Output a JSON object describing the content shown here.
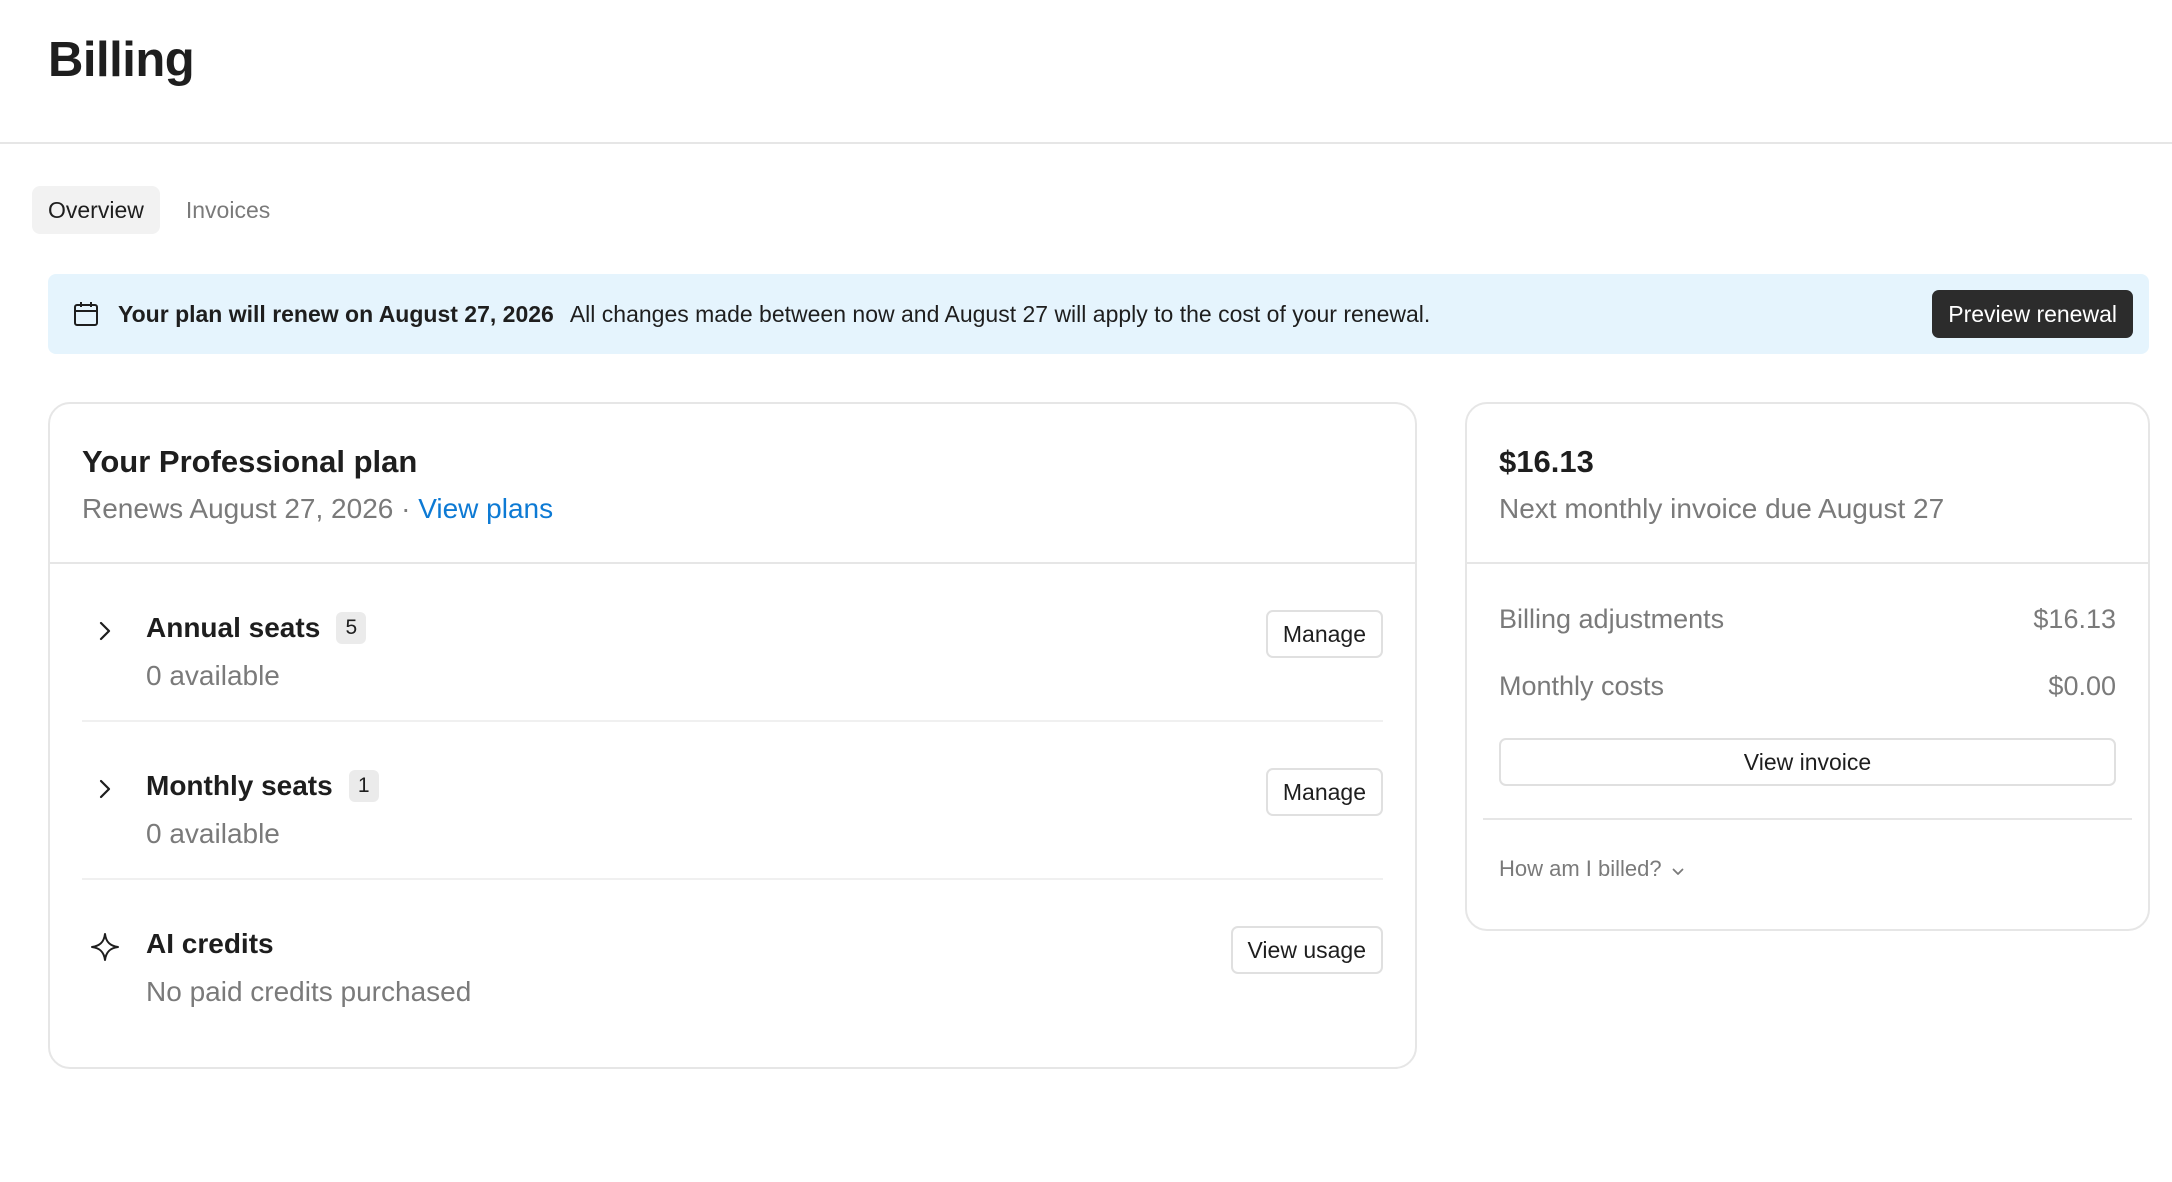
{
  "page": {
    "title": "Billing"
  },
  "tabs": [
    {
      "label": "Overview",
      "active": true
    },
    {
      "label": "Invoices",
      "active": false
    }
  ],
  "banner": {
    "icon": "calendar-icon",
    "strong_text": "Your plan will renew on August 27, 2026",
    "text": "All changes made between now and August 27 will apply to the cost of your renewal.",
    "button_label": "Preview renewal"
  },
  "plan": {
    "title": "Your Professional plan",
    "renews_text": "Renews August 27, 2026 · ",
    "view_plans_label": "View plans",
    "rows": [
      {
        "icon": "chevron-right-icon",
        "title": "Annual seats",
        "count": "5",
        "subtitle": "0 available",
        "action_label": "Manage"
      },
      {
        "icon": "chevron-right-icon",
        "title": "Monthly seats",
        "count": "1",
        "subtitle": "0 available",
        "action_label": "Manage"
      },
      {
        "icon": "sparkle-icon",
        "title": "AI credits",
        "subtitle": "No paid credits purchased",
        "action_label": "View usage"
      }
    ]
  },
  "invoice": {
    "amount": "$16.13",
    "due_text": "Next monthly invoice due August 27",
    "line_items": [
      {
        "label": "Billing adjustments",
        "value": "$16.13"
      },
      {
        "label": "Monthly costs",
        "value": "$0.00"
      }
    ],
    "view_invoice_label": "View invoice",
    "faq_label": "How am I billed?",
    "faq_icon": "chevron-down-icon"
  },
  "colors": {
    "banner_bg": "#e5f4fd",
    "link": "#0d7ad4",
    "dark_button": "#2c2c2c"
  }
}
